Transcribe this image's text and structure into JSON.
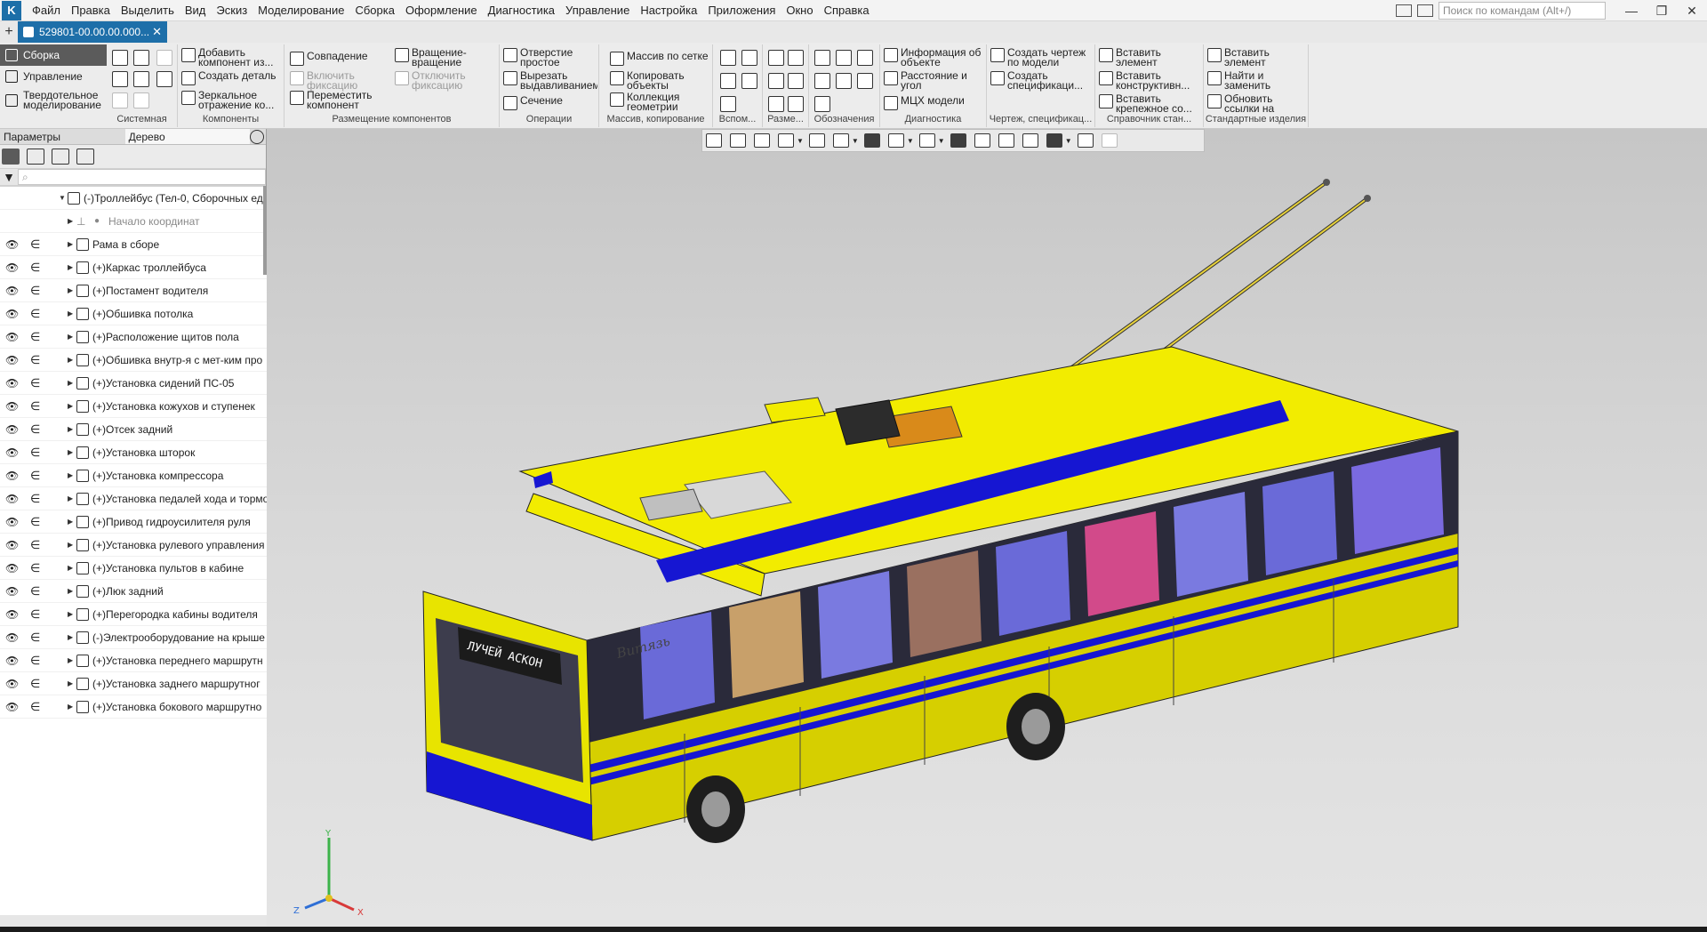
{
  "menubar": {
    "items": [
      "Файл",
      "Правка",
      "Выделить",
      "Вид",
      "Эскиз",
      "Моделирование",
      "Сборка",
      "Оформление",
      "Диагностика",
      "Управление",
      "Настройка",
      "Приложения",
      "Окно",
      "Справка"
    ],
    "search_placeholder": "Поиск по командам (Alt+/)",
    "minimize": "—",
    "restore": "❐",
    "close": "✕"
  },
  "tabbar": {
    "new_tab": "+",
    "doc_tab": "529801-00.00.00.000...",
    "close": "✕"
  },
  "ribbon": {
    "modes": [
      "Сборка",
      "Управление",
      "Твердотельное моделирование"
    ],
    "groups": {
      "system": "Системная",
      "components": "Компоненты",
      "placement": "Размещение компонентов",
      "operations": "Операции",
      "array": "Массив, копирование",
      "aux": "Вспом...",
      "dims": "Разме...",
      "designations": "Обозначения",
      "diagnostics": "Диагностика",
      "drawing": "Чертеж, спецификац...",
      "reference": "Справочник стан...",
      "standard": "Стандартные изделия"
    },
    "buttons": {
      "add_component": "Добавить компонент из...",
      "create_part": "Создать деталь",
      "mirror": "Зеркальное отражение ко...",
      "coincide": "Совпадение",
      "enable_fix": "Включить фиксацию",
      "move_component": "Переместить компонент",
      "rotate": "Вращение-вращение",
      "disable_fix": "Отключить фиксацию",
      "hole": "Отверстие простое",
      "cut_extrude": "Вырезать выдавливанием",
      "section": "Сечение",
      "grid_array": "Массив по сетке",
      "copy_objects": "Копировать объекты",
      "geometry_collection": "Коллекция геометрии",
      "object_info": "Информация об объекте",
      "distance_angle": "Расстояние и угол",
      "mcx": "МЦХ модели",
      "create_drawing": "Создать чертеж по модели",
      "create_spec": "Создать спецификаци...",
      "insert_element": "Вставить элемент",
      "insert_construct": "Вставить конструктивн...",
      "insert_fastener": "Вставить крепежное со...",
      "std_insert_element": "Вставить элемент",
      "find_replace": "Найти и заменить",
      "update_links": "Обновить ссылки на мод..."
    }
  },
  "left_panel": {
    "tabs": [
      "Параметры",
      "Дерево"
    ],
    "search_placeholder": "⌕",
    "root": "(-)Троллейбус (Тел-0, Сборочных ед",
    "origin": "Начало координат",
    "items": [
      "Рама в сборе",
      "(+)Каркас троллейбуса",
      "(+)Постамент водителя",
      "(+)Обшивка потолка",
      "(+)Расположение щитов пола",
      "(+)Обшивка внутр-я с мет-ким про",
      "(+)Установка сидений ПС-05",
      "(+)Установка кожухов и ступенек",
      "(+)Отсек задний",
      "(+)Установка шторок",
      "(+)Установка компрессора",
      "(+)Установка педалей хода и тормо",
      "(+)Привод гидроусилителя руля",
      "(+)Установка рулевого управления",
      "(+)Установка пультов в кабине",
      "(+)Люк задний",
      "(+)Перегородка кабины водителя",
      "(-)Электрооборудование на крыше",
      "(+)Установка переднего маршрутн",
      "(+)Установка заднего маршрутног",
      "(+)Установка бокового маршрутно"
    ]
  },
  "viewport": {
    "destination_sign": "ЛУЧЕЙ АСКОН",
    "side_logo": "Витязь",
    "axis_x": "X",
    "axis_y": "Y",
    "axis_z": "Z"
  },
  "colors": {
    "accent": "#1e6fa9",
    "bus_yellow": "#f5f000",
    "bus_blue": "#1616d2",
    "active_mode": "#5b5b5b"
  }
}
